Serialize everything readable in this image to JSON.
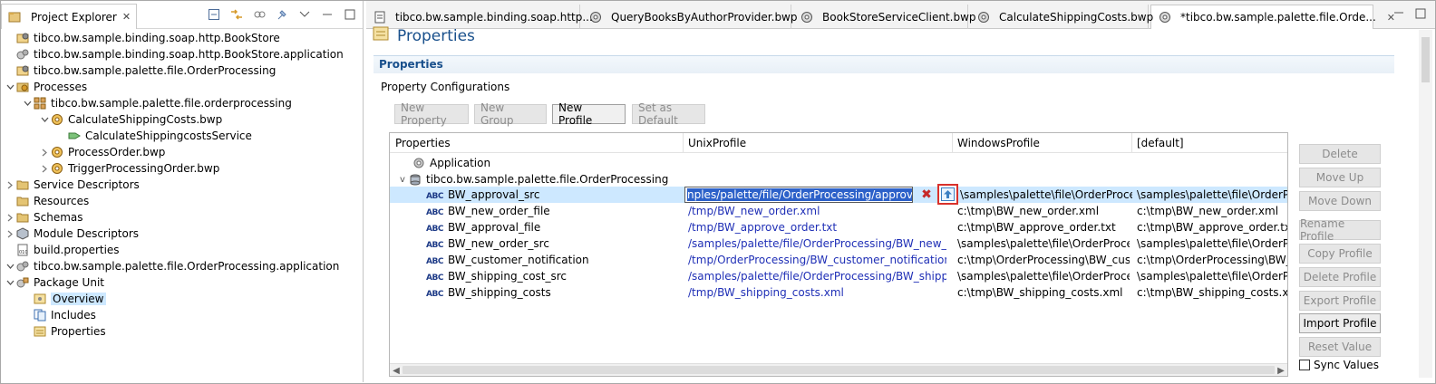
{
  "explorer": {
    "tab_label": "Project Explorer",
    "close_glyph": "✕",
    "tree": [
      {
        "label": "tibco.bw.sample.binding.soap.http.BookStore",
        "level": 0,
        "chev": "",
        "icon": "project-icon"
      },
      {
        "label": "tibco.bw.sample.binding.soap.http.BookStore.application",
        "level": 0,
        "chev": "",
        "icon": "application-icon"
      },
      {
        "label": "tibco.bw.sample.palette.file.OrderProcessing",
        "level": 0,
        "chev": "",
        "icon": "project-icon"
      },
      {
        "label": "Processes",
        "level": 0,
        "chev": "v",
        "icon": "processes-folder-icon"
      },
      {
        "label": "tibco.bw.sample.palette.file.orderprocessing",
        "level": 1,
        "chev": "v",
        "icon": "package-icon"
      },
      {
        "label": "CalculateShippingCosts.bwp",
        "level": 2,
        "chev": "v",
        "icon": "process-icon"
      },
      {
        "label": "CalculateShippingcostsService",
        "level": 3,
        "chev": "",
        "icon": "service-icon"
      },
      {
        "label": "ProcessOrder.bwp",
        "level": 2,
        "chev": ">",
        "icon": "process-icon"
      },
      {
        "label": "TriggerProcessingOrder.bwp",
        "level": 2,
        "chev": ">",
        "icon": "process-icon"
      },
      {
        "label": "Service Descriptors",
        "level": 0,
        "chev": ">",
        "icon": "folder-icon"
      },
      {
        "label": "Resources",
        "level": 0,
        "chev": "",
        "icon": "folder-icon"
      },
      {
        "label": "Schemas",
        "level": 0,
        "chev": ">",
        "icon": "folder-icon"
      },
      {
        "label": "Module Descriptors",
        "level": 0,
        "chev": ">",
        "icon": "module-icon"
      },
      {
        "label": "build.properties",
        "level": 0,
        "chev": "",
        "icon": "file-icon"
      },
      {
        "label": "tibco.bw.sample.palette.file.OrderProcessing.application",
        "level": 0,
        "chev": "v",
        "icon": "application-icon"
      },
      {
        "label": "Package Unit",
        "level": 0,
        "chev": "v",
        "icon": "package-unit-icon"
      },
      {
        "label": "Overview",
        "level": 1,
        "chev": "",
        "icon": "overview-icon",
        "selected": true
      },
      {
        "label": "Includes",
        "level": 1,
        "chev": "",
        "icon": "includes-icon"
      },
      {
        "label": "Properties",
        "level": 1,
        "chev": "",
        "icon": "properties-icon"
      }
    ]
  },
  "editor": {
    "tabs": [
      {
        "label": "tibco.bw.sample.binding.soap.http...",
        "icon": "wsdl-icon"
      },
      {
        "label": "QueryBooksByAuthorProvider.bwp",
        "icon": "gear-icon"
      },
      {
        "label": "BookStoreServiceClient.bwp",
        "icon": "gear-icon"
      },
      {
        "label": "CalculateShippingCosts.bwp",
        "icon": "gear-icon"
      },
      {
        "label": "*tibco.bw.sample.palette.file.Orde...",
        "icon": "gear-icon",
        "active": true
      }
    ],
    "form_title": "Properties",
    "section_title": "Properties",
    "sub_label": "Property Configurations",
    "buttons": {
      "new_property": "New Property",
      "new_group": "New Group",
      "new_profile": "New Profile",
      "set_default": "Set as Default"
    },
    "columns": [
      "Properties",
      "UnixProfile",
      "WindowsProfile",
      "[default]"
    ],
    "group_rows": [
      {
        "label": "Application",
        "icon": "application-icon"
      },
      {
        "label": "tibco.bw.sample.palette.file.OrderProcessing",
        "icon": "module-icon"
      }
    ],
    "rows": [
      {
        "name": "BW_approval_src",
        "unix": "nples/palette/file/OrderProcessing/approve.txt",
        "windows": "\\samples\\palette\\file\\OrderProces...",
        "default": "\\samples\\palette\\file\\OrderPro",
        "editing": true
      },
      {
        "name": "BW_new_order_file",
        "unix": "/tmp/BW_new_order.xml",
        "windows": "c:\\tmp\\BW_new_order.xml",
        "default": "c:\\tmp\\BW_new_order.xml"
      },
      {
        "name": "BW_approval_file",
        "unix": "/tmp/BW_approve_order.txt",
        "windows": "c:\\tmp\\BW_approve_order.txt",
        "default": "c:\\tmp\\BW_approve_order.txt"
      },
      {
        "name": "BW_new_order_src",
        "unix": "/samples/palette/file/OrderProcessing/BW_new_orde...",
        "windows": "\\samples\\palette\\file\\OrderProces...",
        "default": "\\samples\\palette\\file\\OrderPro"
      },
      {
        "name": "BW_customer_notification",
        "unix": "/tmp/OrderProcessing/BW_customer_notification.txt",
        "windows": "c:\\tmp\\OrderProcessing\\BW_cust...",
        "default": "c:\\tmp\\OrderProcessing\\BW_cu"
      },
      {
        "name": "BW_shipping_cost_src",
        "unix": "/samples/palette/file/OrderProcessing/BW_shipping_...",
        "windows": "\\samples\\palette\\file\\OrderProces...",
        "default": "\\samples\\palette\\file\\OrderPro"
      },
      {
        "name": "BW_shipping_costs",
        "unix": "/tmp/BW_shipping_costs.xml",
        "windows": "c:\\tmp\\BW_shipping_costs.xml",
        "default": "c:\\tmp\\BW_shipping_costs.xml"
      }
    ],
    "abc_tag": "ABC",
    "side_buttons": [
      {
        "label": "Delete",
        "enabled": false
      },
      {
        "label": "Move Up",
        "enabled": false
      },
      {
        "label": "Move Down",
        "enabled": false
      },
      {
        "label": "Rename Profile",
        "enabled": false
      },
      {
        "label": "Copy Profile",
        "enabled": false
      },
      {
        "label": "Delete Profile",
        "enabled": false
      },
      {
        "label": "Export Profile",
        "enabled": false
      },
      {
        "label": "Import Profile",
        "enabled": true
      },
      {
        "label": "Reset Value",
        "enabled": false
      }
    ],
    "sync_values_label": "Sync Values"
  },
  "colors": {
    "accent": "#19508c",
    "selection": "#cde8ff",
    "unix_text": "#1f2fb6",
    "highlight_box": "#d9312b"
  }
}
